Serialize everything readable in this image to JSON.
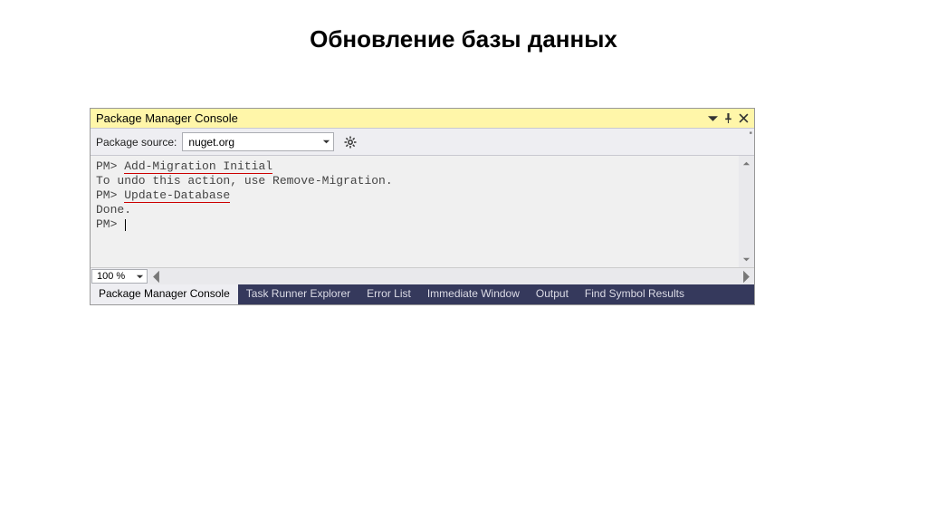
{
  "heading": "Обновление базы данных",
  "titlebar": {
    "title": "Package Manager Console"
  },
  "toolbar": {
    "package_source_label": "Package source:",
    "package_source_value": "nuget.org",
    "overflow_marker": "''"
  },
  "console": {
    "lines": [
      {
        "prefix": "PM> ",
        "text": "Add-Migration Initial",
        "underline": true
      },
      {
        "prefix": "",
        "text": "To undo this action, use Remove-Migration.",
        "underline": false
      },
      {
        "prefix": "PM> ",
        "text": "Update-Database",
        "underline": true
      },
      {
        "prefix": "",
        "text": "Done.",
        "underline": false
      },
      {
        "prefix": "PM> ",
        "text": "",
        "underline": false,
        "cursor": true
      }
    ]
  },
  "zoom_level": "100 %",
  "tabs": [
    {
      "label": "Package Manager Console",
      "active": true
    },
    {
      "label": "Task Runner Explorer",
      "active": false
    },
    {
      "label": "Error List",
      "active": false
    },
    {
      "label": "Immediate Window",
      "active": false
    },
    {
      "label": "Output",
      "active": false
    },
    {
      "label": "Find Symbol Results",
      "active": false
    }
  ]
}
